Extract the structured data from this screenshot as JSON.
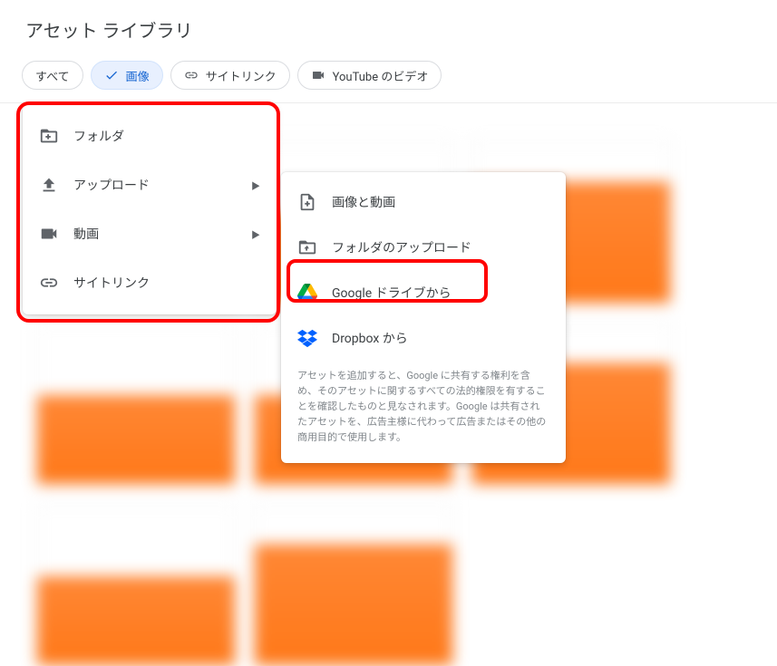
{
  "header": {
    "title": "アセット ライブラリ"
  },
  "filters": {
    "all": "すべて",
    "images": "画像",
    "sitelinks": "サイトリンク",
    "youtube": "YouTube のビデオ"
  },
  "menu_primary": {
    "folder": "フォルダ",
    "upload": "アップロード",
    "video": "動画",
    "sitelink": "サイトリンク"
  },
  "menu_upload": {
    "images_videos": "画像と動画",
    "folder_upload": "フォルダのアップロード",
    "google_drive": "Google ドライブから",
    "dropbox": "Dropbox から",
    "disclaimer": "アセットを追加すると、Google に共有する権利を含め、そのアセットに関するすべての法的権限を有することを確認したものと見なされます。Google は共有されたアセットを、広告主様に代わって広告またはその他の商用目的で使用します。"
  }
}
